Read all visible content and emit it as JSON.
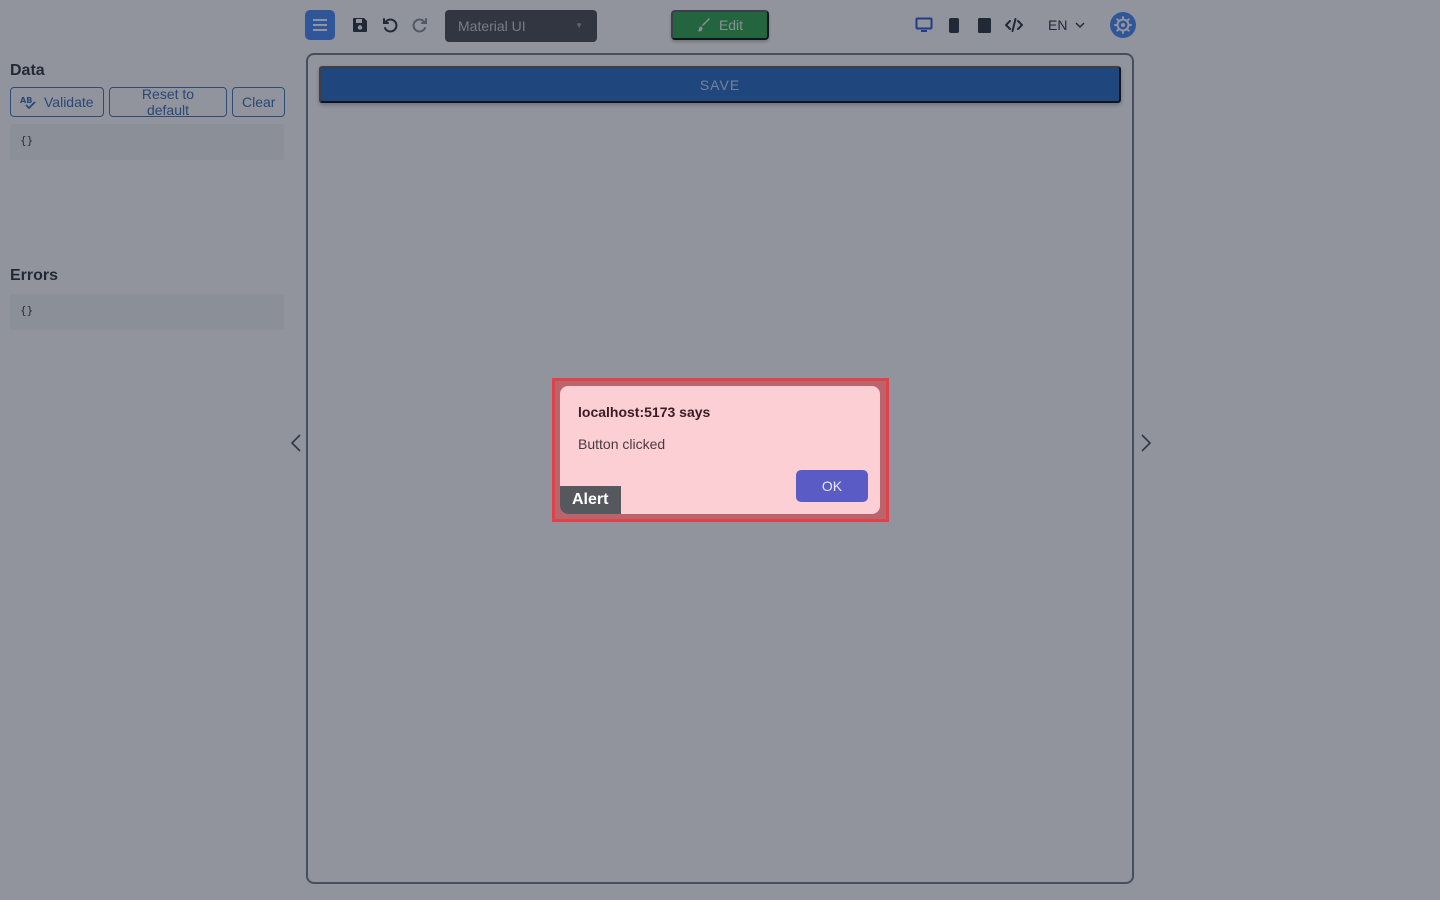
{
  "toolbar": {
    "theme_select": {
      "value": "Material UI"
    },
    "edit_label": "Edit",
    "language": "EN"
  },
  "left_panel": {
    "data_title": "Data",
    "buttons": {
      "validate": "Validate",
      "reset": "Reset to default",
      "clear": "Clear"
    },
    "data_value": "{}",
    "errors_title": "Errors",
    "errors_value": "{}"
  },
  "preview": {
    "save_label": "SAVE"
  },
  "dialog": {
    "title": "localhost:5173 says",
    "message": "Button clicked",
    "ok_label": "OK",
    "tag": "Alert"
  },
  "colors": {
    "accent": "#3b82f6",
    "edit_green": "#22a043",
    "form_save_blue": "#1d64c0",
    "dialog_bg": "#fbcfd3",
    "ok_purple": "#5b5bc6",
    "highlight_red": "#e1414a"
  },
  "icons": [
    "menu-icon",
    "save-icon",
    "undo-icon",
    "redo-icon",
    "brush-icon",
    "desktop-icon",
    "phone-icon",
    "tablet-icon",
    "code-icon",
    "chevron-down-icon",
    "settings-icon",
    "spellcheck-icon",
    "chevron-left-icon",
    "chevron-right-icon"
  ]
}
